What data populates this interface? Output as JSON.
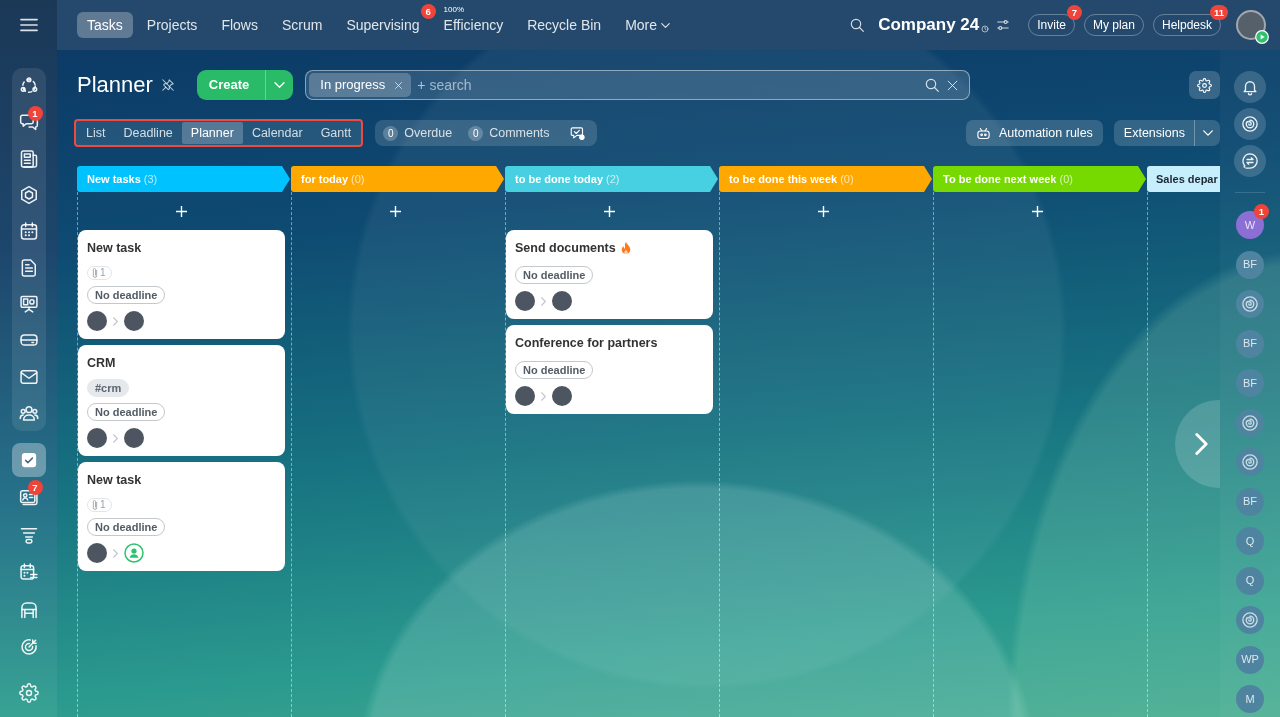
{
  "top_nav": {
    "tabs": [
      {
        "label": "Tasks",
        "selected": true
      },
      {
        "label": "Projects",
        "selected": false
      },
      {
        "label": "Flows",
        "selected": false
      },
      {
        "label": "Scrum",
        "selected": false
      },
      {
        "label": "Supervising",
        "selected": false,
        "badge": "6"
      },
      {
        "label": "Efficiency",
        "selected": false,
        "note": "100%"
      },
      {
        "label": "Recycle Bin",
        "selected": false
      },
      {
        "label": "More",
        "selected": false,
        "dropdown": true
      }
    ]
  },
  "header": {
    "company": "Company 24",
    "buttons": [
      {
        "label": "Invite",
        "badge": "7"
      },
      {
        "label": "My plan"
      },
      {
        "label": "Helpdesk",
        "badge": "11"
      }
    ]
  },
  "left_sidebar": {
    "group": [
      {
        "selected": false
      },
      {
        "selected": false,
        "badge": "1"
      },
      {
        "selected": false
      },
      {
        "selected": false
      },
      {
        "selected": false
      },
      {
        "selected": false
      },
      {
        "selected": false
      },
      {
        "selected": false
      },
      {
        "selected": false
      },
      {
        "selected": false
      }
    ],
    "items": [
      {
        "selected": true
      },
      {
        "selected": false,
        "badge": "7"
      },
      {
        "selected": false
      },
      {
        "selected": false
      },
      {
        "selected": false
      },
      {
        "selected": false
      }
    ]
  },
  "page": {
    "title": "Planner",
    "create": "Create",
    "filters": [
      {
        "label": "In progress"
      }
    ],
    "search_prefix": "+",
    "search_placeholder": "search"
  },
  "views": {
    "highlighted": true,
    "items": [
      {
        "label": "List",
        "selected": false
      },
      {
        "label": "Deadline",
        "selected": false
      },
      {
        "label": "Planner",
        "selected": true
      },
      {
        "label": "Calendar",
        "selected": false
      },
      {
        "label": "Gantt",
        "selected": false
      }
    ]
  },
  "counters": [
    {
      "count": "0",
      "label": "Overdue"
    },
    {
      "count": "0",
      "label": "Comments"
    }
  ],
  "actions": {
    "automation": "Automation rules",
    "extensions": "Extensions"
  },
  "columns": [
    {
      "title": "New tasks",
      "count": "(3)",
      "color": "#00c2ff",
      "add_button": true,
      "cards": [
        {
          "title": "New task",
          "hot": false,
          "attachments": "1",
          "deadline": "No deadline",
          "avatars": [
            {
              "kind": "photo"
            },
            {
              "kind": "photo"
            }
          ]
        },
        {
          "title": "CRM",
          "hot": false,
          "tag": "#crm",
          "deadline": "No deadline",
          "avatars": [
            {
              "kind": "photo"
            },
            {
              "kind": "photo"
            }
          ]
        },
        {
          "title": "New task",
          "hot": false,
          "attachments": "1",
          "deadline": "No deadline",
          "avatars": [
            {
              "kind": "photo"
            },
            {
              "kind": "placeholder"
            }
          ]
        }
      ]
    },
    {
      "title": "for today",
      "count": "(0)",
      "color": "#ffa900",
      "add_button": true
    },
    {
      "title": "to be done today",
      "count": "(2)",
      "color": "#47d0e2",
      "add_button": true,
      "cards": [
        {
          "title": "Send documents",
          "hot": true,
          "deadline": "No deadline",
          "avatars": [
            {
              "kind": "photo"
            },
            {
              "kind": "photo"
            }
          ]
        },
        {
          "title": "Conference for partners",
          "hot": false,
          "deadline": "No deadline",
          "avatars": [
            {
              "kind": "photo"
            },
            {
              "kind": "photo"
            }
          ]
        }
      ]
    },
    {
      "title": "to be done this week",
      "count": "(0)",
      "color": "#ffa900",
      "add_button": true
    },
    {
      "title": "To be done next week",
      "count": "(0)",
      "color": "#76d900",
      "add_button": true
    },
    {
      "title": "Sales depar",
      "color": "#c6eefc",
      "add_button": false
    }
  ],
  "right_sidebar": {
    "items": [
      {
        "kind": "avatar",
        "initials": "W",
        "color": "#8c6fd5",
        "badge": "1"
      },
      {
        "kind": "avatar",
        "initials": "BF",
        "color": "#4f84a0"
      },
      {
        "kind": "channel"
      },
      {
        "kind": "avatar",
        "initials": "BF",
        "color": "#4f84a0"
      },
      {
        "kind": "avatar",
        "initials": "BF",
        "color": "#4f84a0"
      },
      {
        "kind": "channel"
      },
      {
        "kind": "channel"
      },
      {
        "kind": "avatar",
        "initials": "BF",
        "color": "#4f84a0"
      },
      {
        "kind": "avatar",
        "initials": "Q",
        "color": "#4f84a0"
      },
      {
        "kind": "avatar",
        "initials": "Q",
        "color": "#4f84a0"
      },
      {
        "kind": "channel"
      },
      {
        "kind": "avatar",
        "initials": "WP",
        "color": "#4f84a0"
      },
      {
        "kind": "avatar",
        "initials": "M",
        "color": "#4f84a0"
      }
    ]
  }
}
